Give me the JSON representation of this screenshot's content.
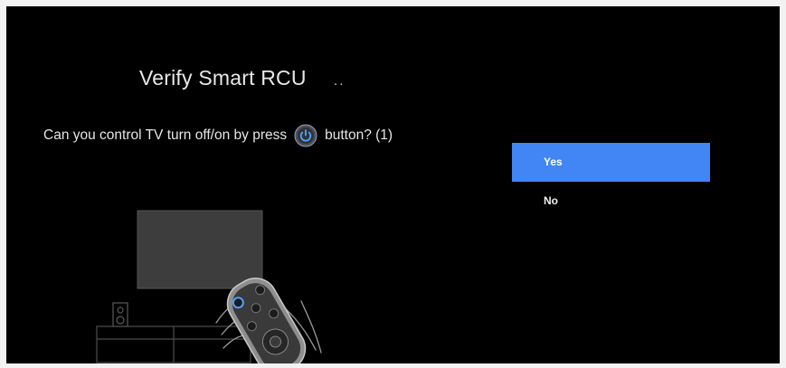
{
  "title": "Verify Smart RCU",
  "title_dots": "..",
  "question": {
    "before": "Can you control TV turn off/on by press",
    "icon": "power-button-icon",
    "after": "button? (1)"
  },
  "options": [
    {
      "label": "Yes",
      "selected": true
    },
    {
      "label": "No",
      "selected": false
    }
  ],
  "colors": {
    "background": "#000000",
    "accent": "#4285f4",
    "text": "#e8e8e8"
  }
}
